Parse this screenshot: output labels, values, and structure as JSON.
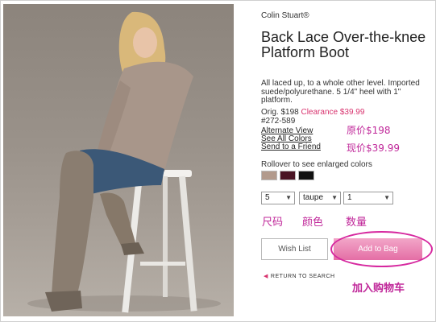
{
  "product": {
    "brand": "Colin Stuart®",
    "title": "Back Lace Over-the-knee Platform Boot",
    "description": "All laced up, to a whole other level. Imported suede/polyurethane. 5 1/4\" heel with 1\" platform.",
    "orig_label": "Orig. $198",
    "clearance_label": "Clearance $39.99",
    "sku": "#272-589"
  },
  "links": {
    "alternate_view": "Alternate View",
    "see_all_colors": "See All Colors",
    "send_to_friend": "Send to a Friend",
    "return_to_search": "RETURN TO SEARCH"
  },
  "colors": {
    "label": "Rollover to see enlarged colors",
    "swatches": [
      {
        "name": "taupe",
        "hex": "#b29a8c"
      },
      {
        "name": "burgundy",
        "hex": "#4a1424"
      },
      {
        "name": "black",
        "hex": "#111111"
      }
    ]
  },
  "selects": {
    "size": "5",
    "color": "taupe",
    "quantity": "1"
  },
  "buttons": {
    "wish_list": "Wish List",
    "add_to_bag": "Add to Bag"
  },
  "annotations": {
    "original_price": "原价$198",
    "current_price": "现价$39.99",
    "size": "尺码",
    "color": "颜色",
    "quantity": "数量",
    "add_to_cart": "加入购物车"
  }
}
